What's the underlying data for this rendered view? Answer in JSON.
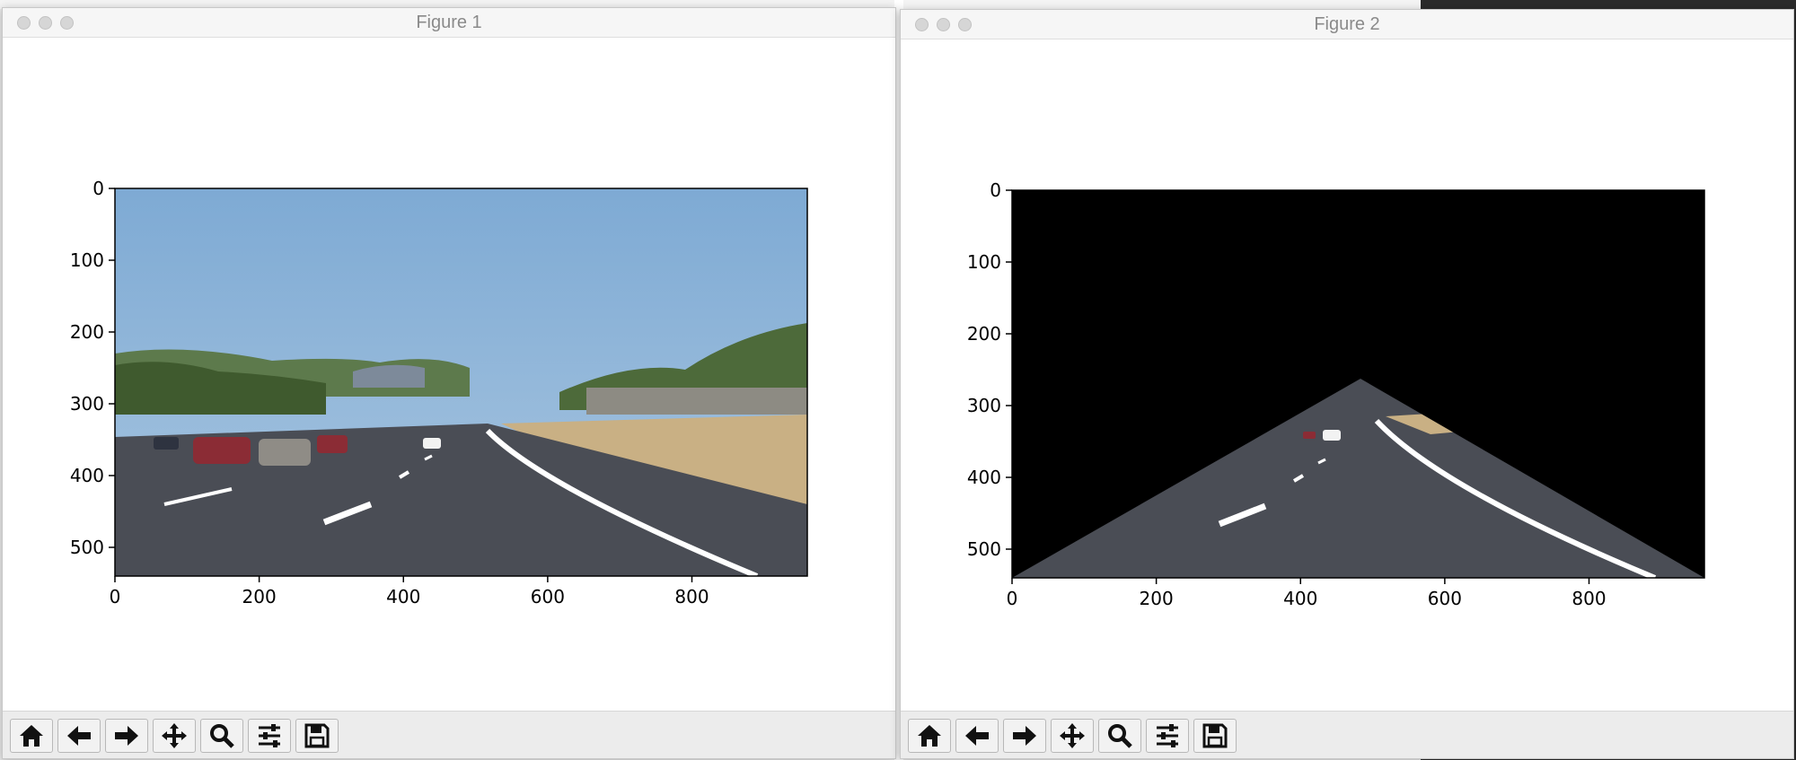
{
  "figures": [
    {
      "title": "Figure 1",
      "image_description": "road-full",
      "x_ticks": [
        "0",
        "200",
        "400",
        "600",
        "800"
      ],
      "y_ticks": [
        "0",
        "100",
        "200",
        "300",
        "400",
        "500"
      ]
    },
    {
      "title": "Figure 2",
      "image_description": "road-masked-triangle",
      "x_ticks": [
        "0",
        "200",
        "400",
        "600",
        "800"
      ],
      "y_ticks": [
        "0",
        "100",
        "200",
        "300",
        "400",
        "500"
      ]
    }
  ],
  "toolbar": {
    "buttons": [
      {
        "name": "home-icon",
        "label": "Home"
      },
      {
        "name": "back-arrow-icon",
        "label": "Back"
      },
      {
        "name": "forward-arrow-icon",
        "label": "Forward"
      },
      {
        "name": "pan-move-icon",
        "label": "Pan"
      },
      {
        "name": "zoom-magnifier-icon",
        "label": "Zoom"
      },
      {
        "name": "sliders-icon",
        "label": "Configure subplots"
      },
      {
        "name": "save-floppy-icon",
        "label": "Save"
      }
    ]
  },
  "colors": {
    "sky": "#8fb4d6",
    "road": "#4a4d55",
    "grass": "#c9b084",
    "trees": "#4d6a3a",
    "lane": "#ffffff",
    "mask": "#000000"
  }
}
